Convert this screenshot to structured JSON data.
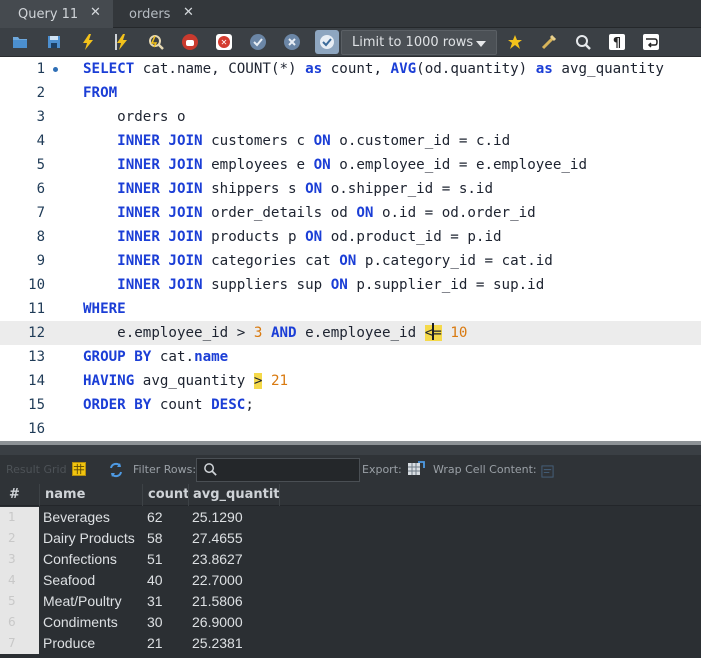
{
  "tabs": [
    {
      "label": "Query 11",
      "active": true
    },
    {
      "label": "orders",
      "active": false
    }
  ],
  "toolbar": {
    "icons": [
      "open-folder-icon",
      "save-icon",
      "execute-icon",
      "execute-current-icon",
      "explain-icon",
      "stop-icon",
      "toggle-continue-icon",
      "commit-icon",
      "rollback-icon",
      "autocommit-icon",
      "add-snippet-icon",
      "beautify-icon",
      "find-icon",
      "invisible-chars-icon",
      "wrap-lines-icon"
    ],
    "limit_label": "Limit to 1000 rows"
  },
  "editor": {
    "lines": [
      {
        "n": "1",
        "marker": true
      },
      {
        "n": "2"
      },
      {
        "n": "3"
      },
      {
        "n": "4"
      },
      {
        "n": "5"
      },
      {
        "n": "6"
      },
      {
        "n": "7"
      },
      {
        "n": "8"
      },
      {
        "n": "9"
      },
      {
        "n": "10"
      },
      {
        "n": "11"
      },
      {
        "n": "12"
      },
      {
        "n": "13"
      },
      {
        "n": "14"
      },
      {
        "n": "15"
      },
      {
        "n": "16"
      }
    ]
  },
  "results_toolbar": {
    "result_grid_label": "Result Grid",
    "filter_label": "Filter Rows:",
    "filter_placeholder": "",
    "export_label": "Export:",
    "wrap_label": "Wrap Cell Content:"
  },
  "grid": {
    "columns": [
      "#",
      "name",
      "count",
      "avg_quantity"
    ],
    "rows": [
      {
        "n": "1",
        "name": "Beverages",
        "count": "62",
        "avg": "25.1290"
      },
      {
        "n": "2",
        "name": "Dairy Products",
        "count": "58",
        "avg": "27.4655"
      },
      {
        "n": "3",
        "name": "Confections",
        "count": "51",
        "avg": "23.8627"
      },
      {
        "n": "4",
        "name": "Seafood",
        "count": "40",
        "avg": "22.7000"
      },
      {
        "n": "5",
        "name": "Meat/Poultry",
        "count": "31",
        "avg": "21.5806"
      },
      {
        "n": "6",
        "name": "Condiments",
        "count": "30",
        "avg": "26.9000"
      },
      {
        "n": "7",
        "name": "Produce",
        "count": "21",
        "avg": "25.2381"
      }
    ]
  },
  "colors": {
    "keyword": "#1b3ed6",
    "number": "#d97a10",
    "highlight": "#f5d94a"
  }
}
